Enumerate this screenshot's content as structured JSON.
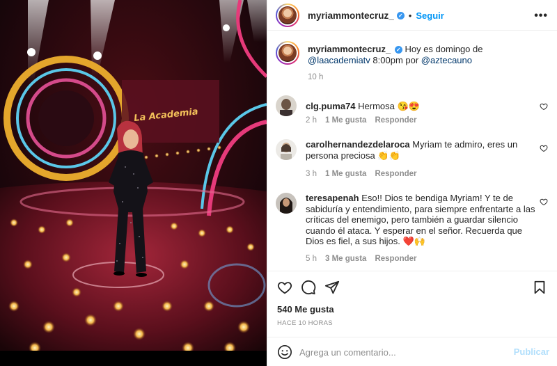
{
  "post": {
    "author": "myriammontecruz_",
    "verified_mark": "✓",
    "follow_label": "Seguir",
    "dot": "•",
    "more_label": "•••"
  },
  "caption": {
    "author": "myriammontecruz_",
    "text_before": "Hoy es domingo de ",
    "mention1": "@laacademiatv",
    "text_middle": " 8:00pm por ",
    "mention2": "@aztecauno",
    "time": "10 h"
  },
  "comments": [
    {
      "user": "clg.puma74",
      "text": "Hermosa 😘😍",
      "time": "2 h",
      "likes": "1 Me gusta",
      "reply": "Responder"
    },
    {
      "user": "carolhernandezdelaroca",
      "text": "Myriam te admiro, eres un persona preciosa 👏👏",
      "time": "3 h",
      "likes": "1 Me gusta",
      "reply": "Responder"
    },
    {
      "user": "teresapenah",
      "text": "Eso!! Dios te bendiga Myriam! Y te de sabiduría y entendimiento, para siempre enfrentarte a las críticas del enemigo, pero también a guardar silencio cuando él ataca. Y esperar en el señor. Recuerda que Dios es fiel, a sus hijos. ❤️🙌",
      "time": "5 h",
      "likes": "3 Me gusta",
      "reply": "Responder"
    }
  ],
  "stats": {
    "likes": "540 Me gusta",
    "posted": "HACE 10 HORAS"
  },
  "composer": {
    "placeholder": "Agrega un comentario...",
    "publish_label": "Publicar"
  },
  "photo": {
    "stage_logo": "La Academia"
  },
  "icons": {
    "like": "heart-icon",
    "comment": "comment-icon",
    "share": "paper-plane-icon",
    "save": "bookmark-icon",
    "emoji": "smiley-icon",
    "more": "ellipsis-icon"
  },
  "colors": {
    "link": "#00376b",
    "follow": "#0095f6",
    "verified": "#3897f0",
    "muted": "#8e8e8e",
    "publish_disabled": "#b2dffc"
  }
}
